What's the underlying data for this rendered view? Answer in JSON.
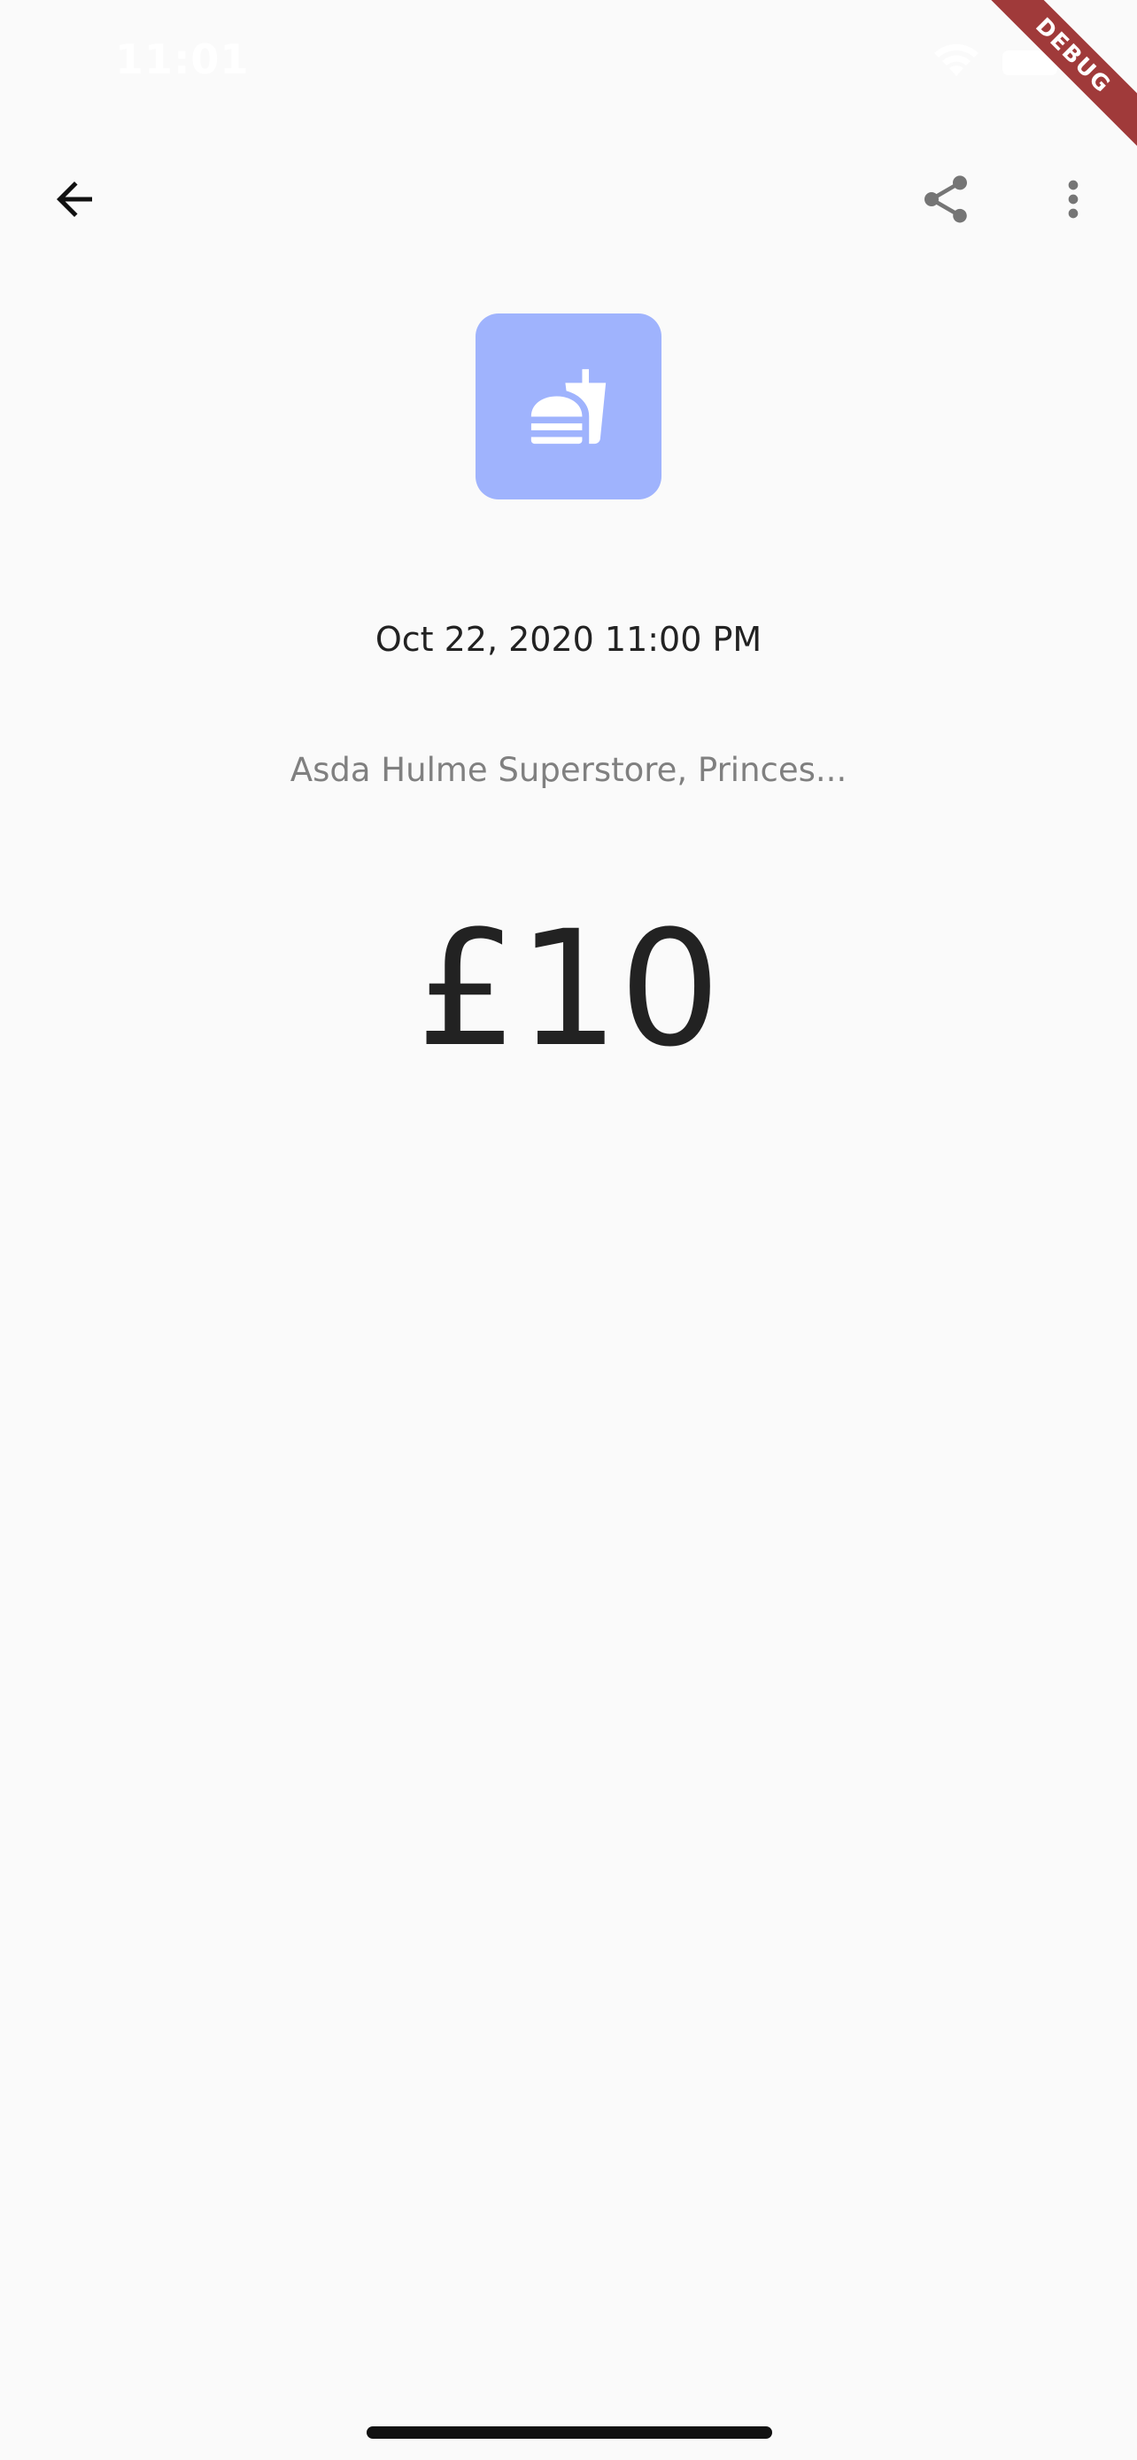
{
  "status_bar": {
    "time": "11:01"
  },
  "debug_banner": {
    "label": "DEBUG"
  },
  "app_bar": {
    "back_icon": "arrow-left-icon",
    "share_icon": "share-icon",
    "more_icon": "more-vertical-icon"
  },
  "category": {
    "icon": "fastfood-icon",
    "color": "#9fb3fd"
  },
  "transaction": {
    "date": "Oct 22, 2020 11:00 PM",
    "location": "Asda Hulme Superstore, Princes...",
    "amount": "£10"
  },
  "colors": {
    "background": "#fafafa",
    "primary_text": "#222222",
    "secondary_text": "#808080",
    "icon_grey": "#757575",
    "debug_red": "#a03a3a"
  }
}
